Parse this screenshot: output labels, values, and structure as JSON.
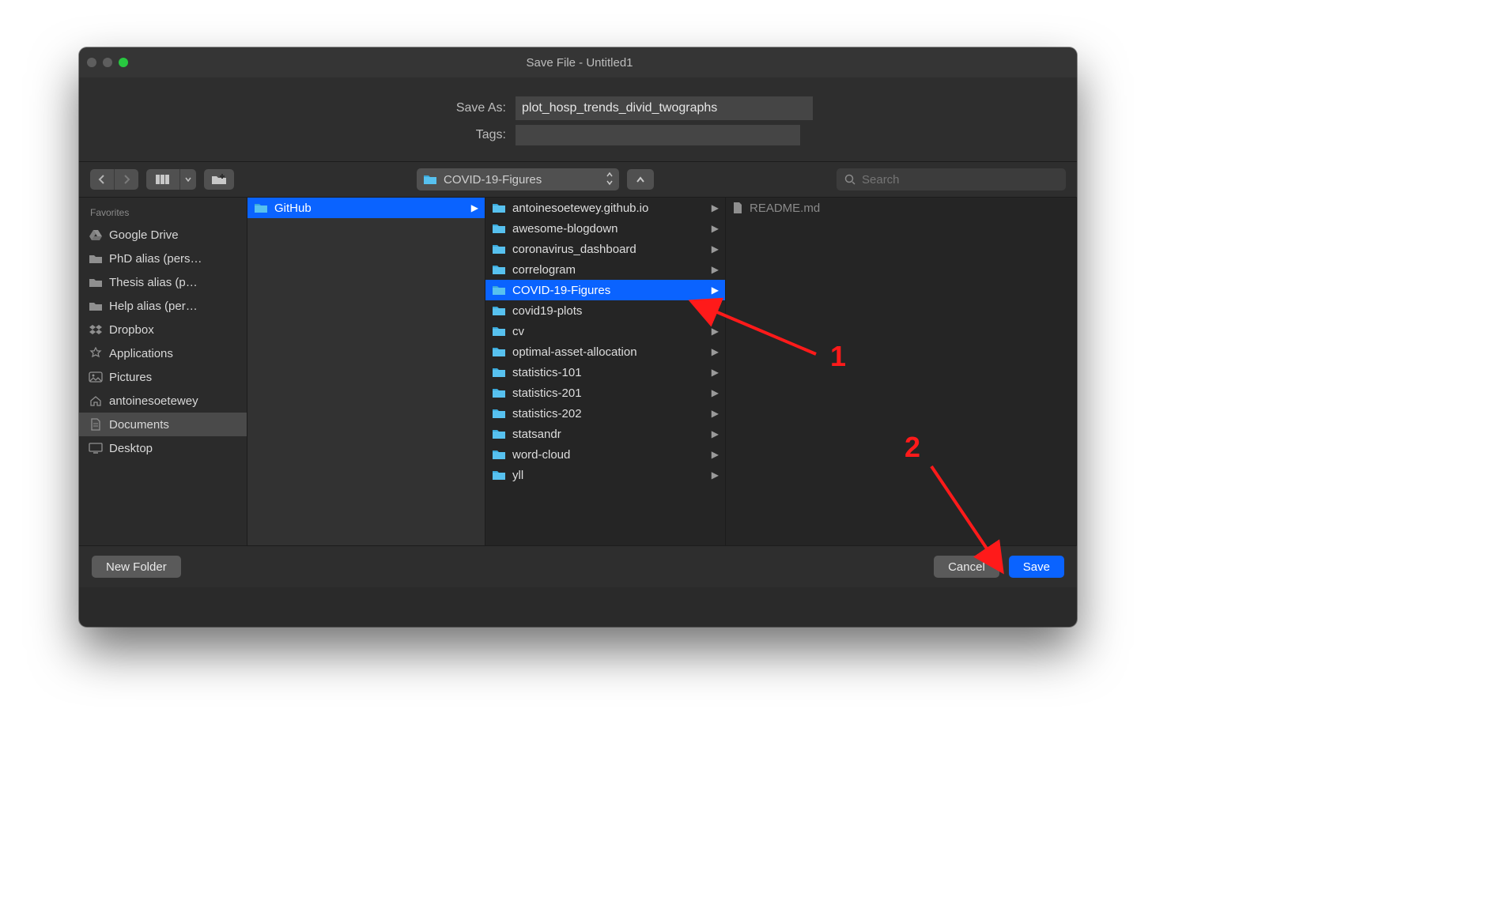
{
  "window": {
    "title": "Save File - Untitled1"
  },
  "form": {
    "save_as_label": "Save As:",
    "save_as_value": "plot_hosp_trends_divid_twographs",
    "tags_label": "Tags:"
  },
  "toolbar": {
    "path_label": "COVID-19-Figures",
    "search_placeholder": "Search"
  },
  "sidebar": {
    "header": "Favorites",
    "items": [
      {
        "icon": "gdrive",
        "label": "Google Drive"
      },
      {
        "icon": "folder-gray",
        "label": "PhD alias (pers…"
      },
      {
        "icon": "folder-gray",
        "label": "Thesis alias (p…"
      },
      {
        "icon": "folder-gray",
        "label": "Help alias (per…"
      },
      {
        "icon": "dropbox",
        "label": "Dropbox"
      },
      {
        "icon": "applications",
        "label": "Applications"
      },
      {
        "icon": "pictures",
        "label": "Pictures"
      },
      {
        "icon": "home",
        "label": "antoinesoetewey"
      },
      {
        "icon": "documents",
        "label": "Documents",
        "selected": true
      },
      {
        "icon": "desktop",
        "label": "Desktop"
      }
    ]
  },
  "columns": {
    "col0": [
      {
        "type": "folder",
        "label": "GitHub",
        "selected": true,
        "hasChildren": true
      }
    ],
    "col1": [
      {
        "type": "folder",
        "label": "antoinesoetewey.github.io",
        "hasChildren": true
      },
      {
        "type": "folder",
        "label": "awesome-blogdown",
        "hasChildren": true
      },
      {
        "type": "folder",
        "label": "coronavirus_dashboard",
        "hasChildren": true
      },
      {
        "type": "folder",
        "label": "correlogram",
        "hasChildren": true
      },
      {
        "type": "folder",
        "label": "COVID-19-Figures",
        "selected": true,
        "hasChildren": true
      },
      {
        "type": "folder",
        "label": "covid19-plots",
        "hasChildren": true
      },
      {
        "type": "folder",
        "label": "cv",
        "hasChildren": true
      },
      {
        "type": "folder",
        "label": "optimal-asset-allocation",
        "hasChildren": true
      },
      {
        "type": "folder",
        "label": "statistics-101",
        "hasChildren": true
      },
      {
        "type": "folder",
        "label": "statistics-201",
        "hasChildren": true
      },
      {
        "type": "folder",
        "label": "statistics-202",
        "hasChildren": true
      },
      {
        "type": "folder",
        "label": "statsandr",
        "hasChildren": true
      },
      {
        "type": "folder",
        "label": "word-cloud",
        "hasChildren": true
      },
      {
        "type": "folder",
        "label": "yll",
        "hasChildren": true
      }
    ],
    "col2": [
      {
        "type": "file",
        "label": "README.md",
        "dim": true
      }
    ]
  },
  "footer": {
    "new_folder": "New Folder",
    "cancel": "Cancel",
    "save": "Save"
  },
  "annotations": {
    "one": "1",
    "two": "2"
  }
}
